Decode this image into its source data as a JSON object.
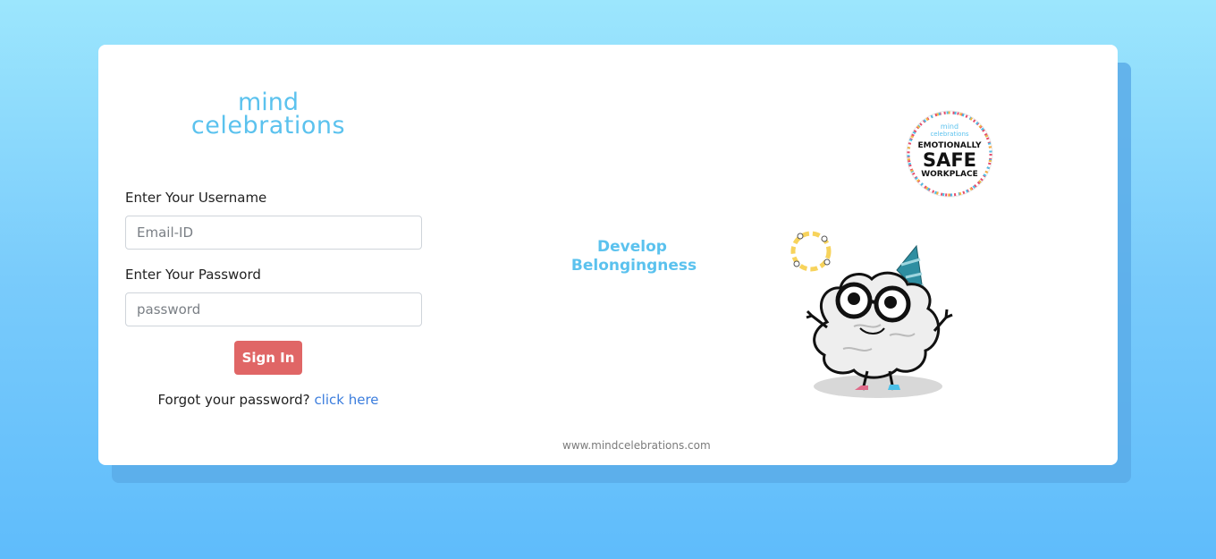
{
  "brand": {
    "line1": "mind",
    "line2": "celebrations"
  },
  "login": {
    "username_label": "Enter Your Username",
    "username_placeholder": "Email-ID",
    "password_label": "Enter Your Password",
    "password_placeholder": "password",
    "signin_label": "Sign In",
    "forgot_text": "Forgot your password?",
    "forgot_link": "click here"
  },
  "hero": {
    "headline_line1": "Develop",
    "headline_line2": "Belongingness",
    "badge_brand_line1": "mind",
    "badge_brand_line2": "celebrations",
    "badge_line1": "EMOTIONALLY",
    "badge_line2": "SAFE",
    "badge_line3": "WORKPLACE",
    "url": "www.mindcelebrations.com"
  },
  "colors": {
    "brand_blue": "#5bc2ee",
    "signin_red": "#e06666",
    "link_blue": "#3b7ddd",
    "background_top": "#9ce6fd",
    "background_bottom": "#5fbcfb"
  },
  "icons": [
    "brain-mascot-icon",
    "party-hat-icon",
    "belonging-circle-icon",
    "safe-workplace-badge-icon"
  ]
}
